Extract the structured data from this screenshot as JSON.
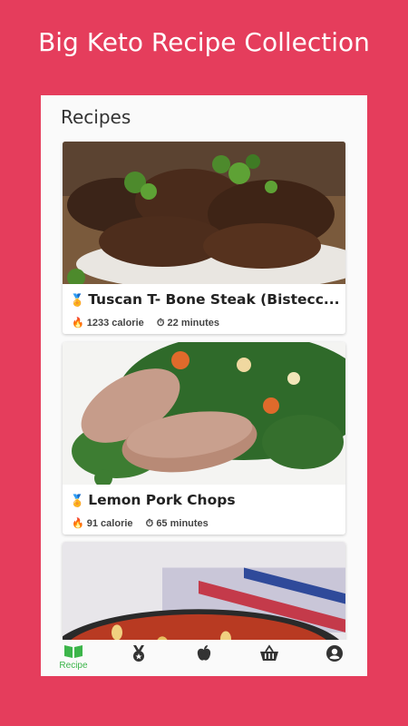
{
  "banner": {
    "title": "Big Keto Recipe Collection"
  },
  "screen": {
    "title": "Recipes"
  },
  "recipes": [
    {
      "title": "Tuscan T- Bone Steak  (Bistecc...",
      "calories": "1233 calorie",
      "time": "22 minutes"
    },
    {
      "title": "Lemon Pork Chops",
      "calories": "91 calorie",
      "time": "65 minutes"
    },
    {
      "title": "",
      "calories": "",
      "time": ""
    }
  ],
  "nav": {
    "items": [
      {
        "icon": "book-icon",
        "label": "Recipe",
        "active": true
      },
      {
        "icon": "medal-icon",
        "label": ""
      },
      {
        "icon": "apple-icon",
        "label": ""
      },
      {
        "icon": "basket-icon",
        "label": ""
      },
      {
        "icon": "account-icon",
        "label": ""
      }
    ]
  },
  "colors": {
    "background": "#e53d5c",
    "active": "#3cb54a",
    "medal": "#e6a817"
  }
}
